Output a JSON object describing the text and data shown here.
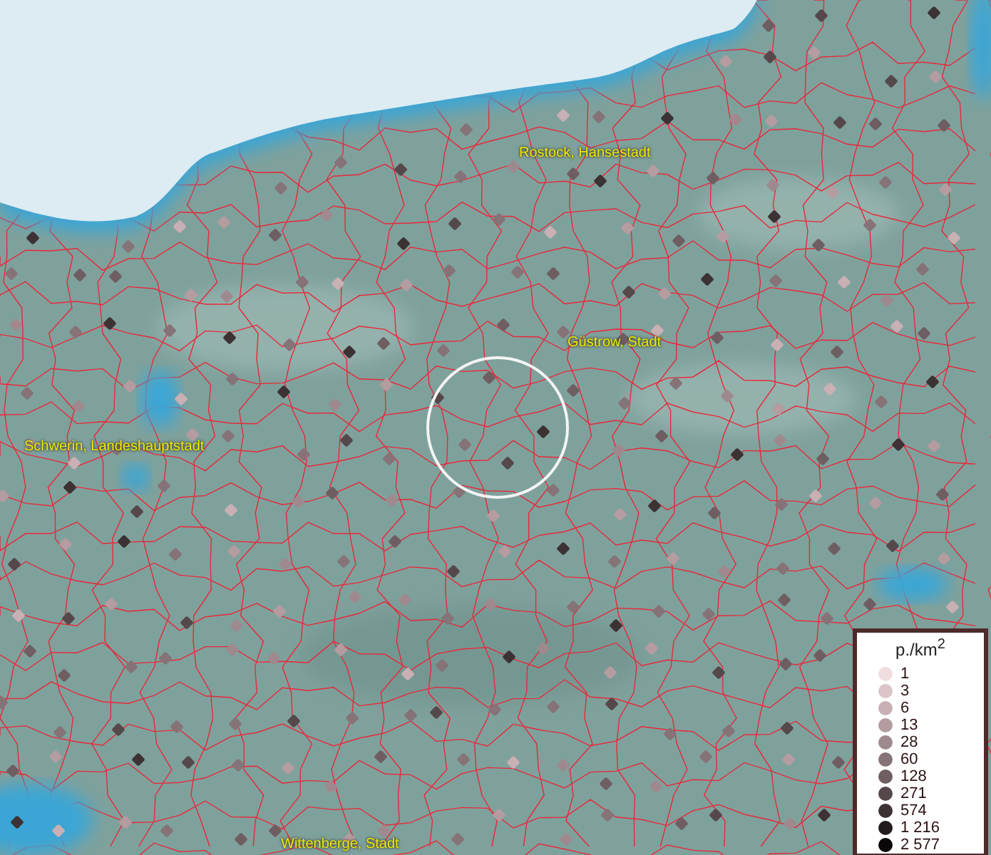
{
  "map": {
    "places": [
      {
        "name": "Rostock, Hansestadt"
      },
      {
        "name": "Güstrow, Stadt"
      },
      {
        "name": "Schwerin, Landeshauptstadt"
      },
      {
        "name": "Wittenberge, Stadt"
      }
    ]
  },
  "legend": {
    "title": "p./km$^{2}$",
    "items": [
      {
        "label": "1",
        "color": "#f0dde0"
      },
      {
        "label": "3",
        "color": "#dcc4c8"
      },
      {
        "label": "6",
        "color": "#c8b0b4"
      },
      {
        "label": "13",
        "color": "#b49ca0"
      },
      {
        "label": "28",
        "color": "#9e8a8e"
      },
      {
        "label": "60",
        "color": "#857377"
      },
      {
        "label": "128",
        "color": "#6e5e62"
      },
      {
        "label": "271",
        "color": "#55484b"
      },
      {
        "label": "574",
        "color": "#3c3234"
      },
      {
        "label": "1 216",
        "color": "#231c1e"
      },
      {
        "label": "2 577",
        "color": "#0a0808"
      }
    ]
  }
}
